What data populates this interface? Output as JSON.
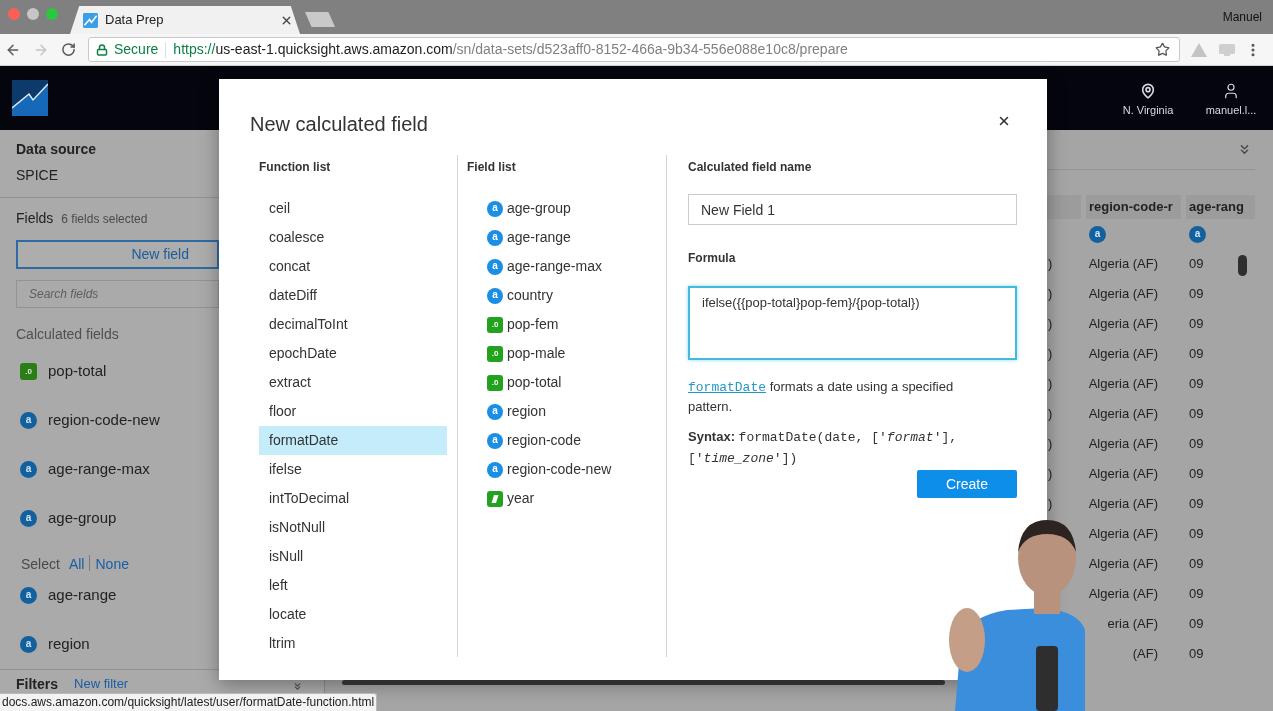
{
  "browser": {
    "tab": {
      "title": "Data Prep"
    },
    "profile": "Manuel",
    "address": {
      "security": "Secure",
      "scheme": "https://",
      "host": "us-east-1.quicksight.aws.amazon.com",
      "path": "/sn/data-sets/d523aff0-8152-466a-9b34-556e088e10c8/prepare"
    },
    "status_url": "docs.aws.amazon.com/quicksight/latest/user/formatDate-function.html"
  },
  "header": {
    "region": "N. Virginia",
    "user": "manuel.l..."
  },
  "sidebar": {
    "data_source": {
      "title": "Data source",
      "value": "SPICE"
    },
    "fields": {
      "title": "Fields",
      "summary": "6 fields selected",
      "new_button": "New field",
      "search_placeholder": "Search fields"
    },
    "calculated": {
      "title": "Calculated fields",
      "items": [
        {
          "name": "pop-total",
          "kind": "number",
          "glyph": ".0"
        },
        {
          "name": "region-code-new",
          "kind": "string",
          "glyph": "a"
        },
        {
          "name": "age-range-max",
          "kind": "string",
          "glyph": "a"
        },
        {
          "name": "age-group",
          "kind": "string",
          "glyph": "a"
        }
      ]
    },
    "select": {
      "label": "Select",
      "all": "All",
      "none": "None"
    },
    "items": [
      {
        "name": "age-range",
        "kind": "string",
        "glyph": "a"
      },
      {
        "name": "region",
        "kind": "string",
        "glyph": "a"
      }
    ],
    "filters": {
      "title": "Filters",
      "link": "New filter"
    }
  },
  "table": {
    "columns": [
      {
        "kind": "cut"
      },
      {
        "kind": "string",
        "header": "region-code-r",
        "glyph": "a"
      },
      {
        "kind": "string",
        "header": "age-rang",
        "glyph": "a"
      }
    ],
    "rows": [
      [
        ")",
        "Algeria (AF)",
        "09"
      ],
      [
        ")",
        "Algeria (AF)",
        "09"
      ],
      [
        ")",
        "Algeria (AF)",
        "09"
      ],
      [
        ")",
        "Algeria (AF)",
        "09"
      ],
      [
        ")",
        "Algeria (AF)",
        "09"
      ],
      [
        ")",
        "Algeria (AF)",
        "09"
      ],
      [
        ")",
        "Algeria (AF)",
        "09"
      ],
      [
        ")",
        "Algeria (AF)",
        "09"
      ],
      [
        ")",
        "Algeria (AF)",
        "09"
      ],
      [
        null,
        "Algeria (AF)",
        "09"
      ],
      [
        null,
        "Algeria (AF)",
        "09"
      ],
      [
        null,
        "Algeria (AF)",
        "09"
      ],
      [
        null,
        "eria (AF)",
        "09"
      ],
      [
        null,
        "(AF)",
        "09"
      ]
    ]
  },
  "dialog": {
    "title": "New calculated field",
    "functions": {
      "heading": "Function list",
      "items": [
        {
          "name": "ceil",
          "selected": false
        },
        {
          "name": "coalesce",
          "selected": false
        },
        {
          "name": "concat",
          "selected": false
        },
        {
          "name": "dateDiff",
          "selected": false
        },
        {
          "name": "decimalToInt",
          "selected": false
        },
        {
          "name": "epochDate",
          "selected": false
        },
        {
          "name": "extract",
          "selected": false
        },
        {
          "name": "floor",
          "selected": false
        },
        {
          "name": "formatDate",
          "selected": true
        },
        {
          "name": "ifelse",
          "selected": false
        },
        {
          "name": "intToDecimal",
          "selected": false
        },
        {
          "name": "isNotNull",
          "selected": false
        },
        {
          "name": "isNull",
          "selected": false
        },
        {
          "name": "left",
          "selected": false
        },
        {
          "name": "locate",
          "selected": false
        },
        {
          "name": "ltrim",
          "selected": false
        }
      ]
    },
    "fields": {
      "heading": "Field list",
      "items": [
        {
          "name": "age-group",
          "kind": "string",
          "glyph": "a"
        },
        {
          "name": "age-range",
          "kind": "string",
          "glyph": "a"
        },
        {
          "name": "age-range-max",
          "kind": "string",
          "glyph": "a"
        },
        {
          "name": "country",
          "kind": "string",
          "glyph": "a"
        },
        {
          "name": "pop-fem",
          "kind": "number",
          "glyph": ".0"
        },
        {
          "name": "pop-male",
          "kind": "number",
          "glyph": ".0"
        },
        {
          "name": "pop-total",
          "kind": "number",
          "glyph": ".0"
        },
        {
          "name": "region",
          "kind": "string",
          "glyph": "a"
        },
        {
          "name": "region-code",
          "kind": "string",
          "glyph": "a"
        },
        {
          "name": "region-code-new",
          "kind": "string",
          "glyph": "a"
        },
        {
          "name": "year",
          "kind": "date"
        }
      ]
    },
    "name_field": {
      "label": "Calculated field name",
      "value": "New Field 1"
    },
    "formula": {
      "label": "Formula",
      "value": "ifelse({{pop-total}pop-fem}/{pop-total})",
      "focused": true
    },
    "help": {
      "link": "formatDate",
      "text": "formats a date using a specified pattern."
    },
    "syntax": {
      "label": "Syntax:",
      "code": "formatDate(date, ['*format*'], ['*time_zone*'])"
    },
    "create_button": "Create"
  }
}
